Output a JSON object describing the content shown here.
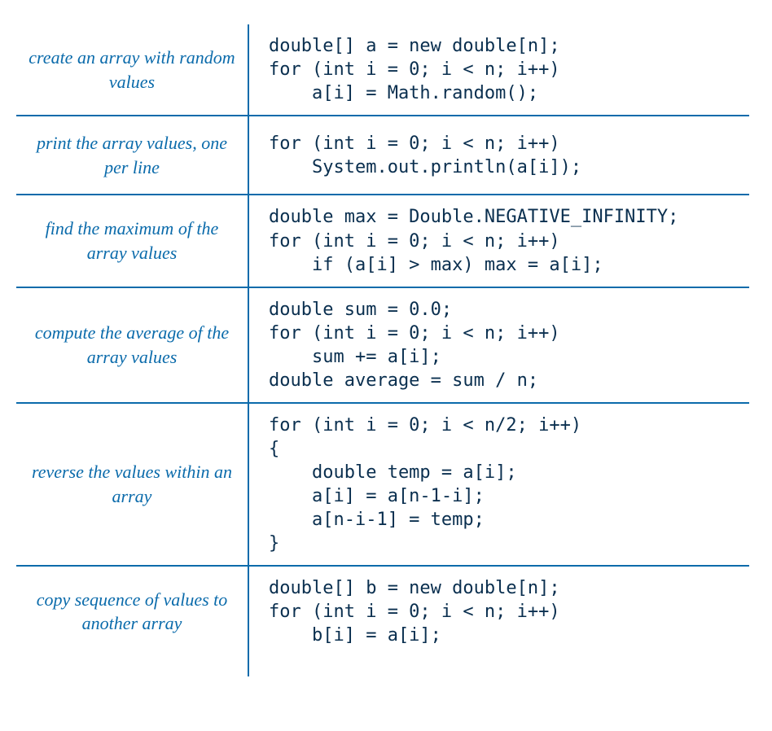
{
  "rows": [
    {
      "desc": "create an array\nwith random values",
      "code": "double[] a = new double[n];\nfor (int i = 0; i < n; i++)\n    a[i] = Math.random();"
    },
    {
      "desc": "print the array values,\none per line",
      "code": "for (int i = 0; i < n; i++)\n    System.out.println(a[i]);"
    },
    {
      "desc": "find the maximum of\nthe array values",
      "code": "double max = Double.NEGATIVE_INFINITY;\nfor (int i = 0; i < n; i++)\n    if (a[i] > max) max = a[i];"
    },
    {
      "desc": "compute the average of\nthe array values",
      "code": "double sum = 0.0;\nfor (int i = 0; i < n; i++)\n    sum += a[i];\ndouble average = sum / n;"
    },
    {
      "desc": "reverse the values\nwithin an array",
      "code": "for (int i = 0; i < n/2; i++)\n{\n    double temp = a[i];\n    a[i] = a[n-1-i];\n    a[n-i-1] = temp;\n}"
    },
    {
      "desc": "copy sequence of values\nto another array",
      "code": "double[] b = new double[n];\nfor (int i = 0; i < n; i++)\n    b[i] = a[i];"
    }
  ]
}
